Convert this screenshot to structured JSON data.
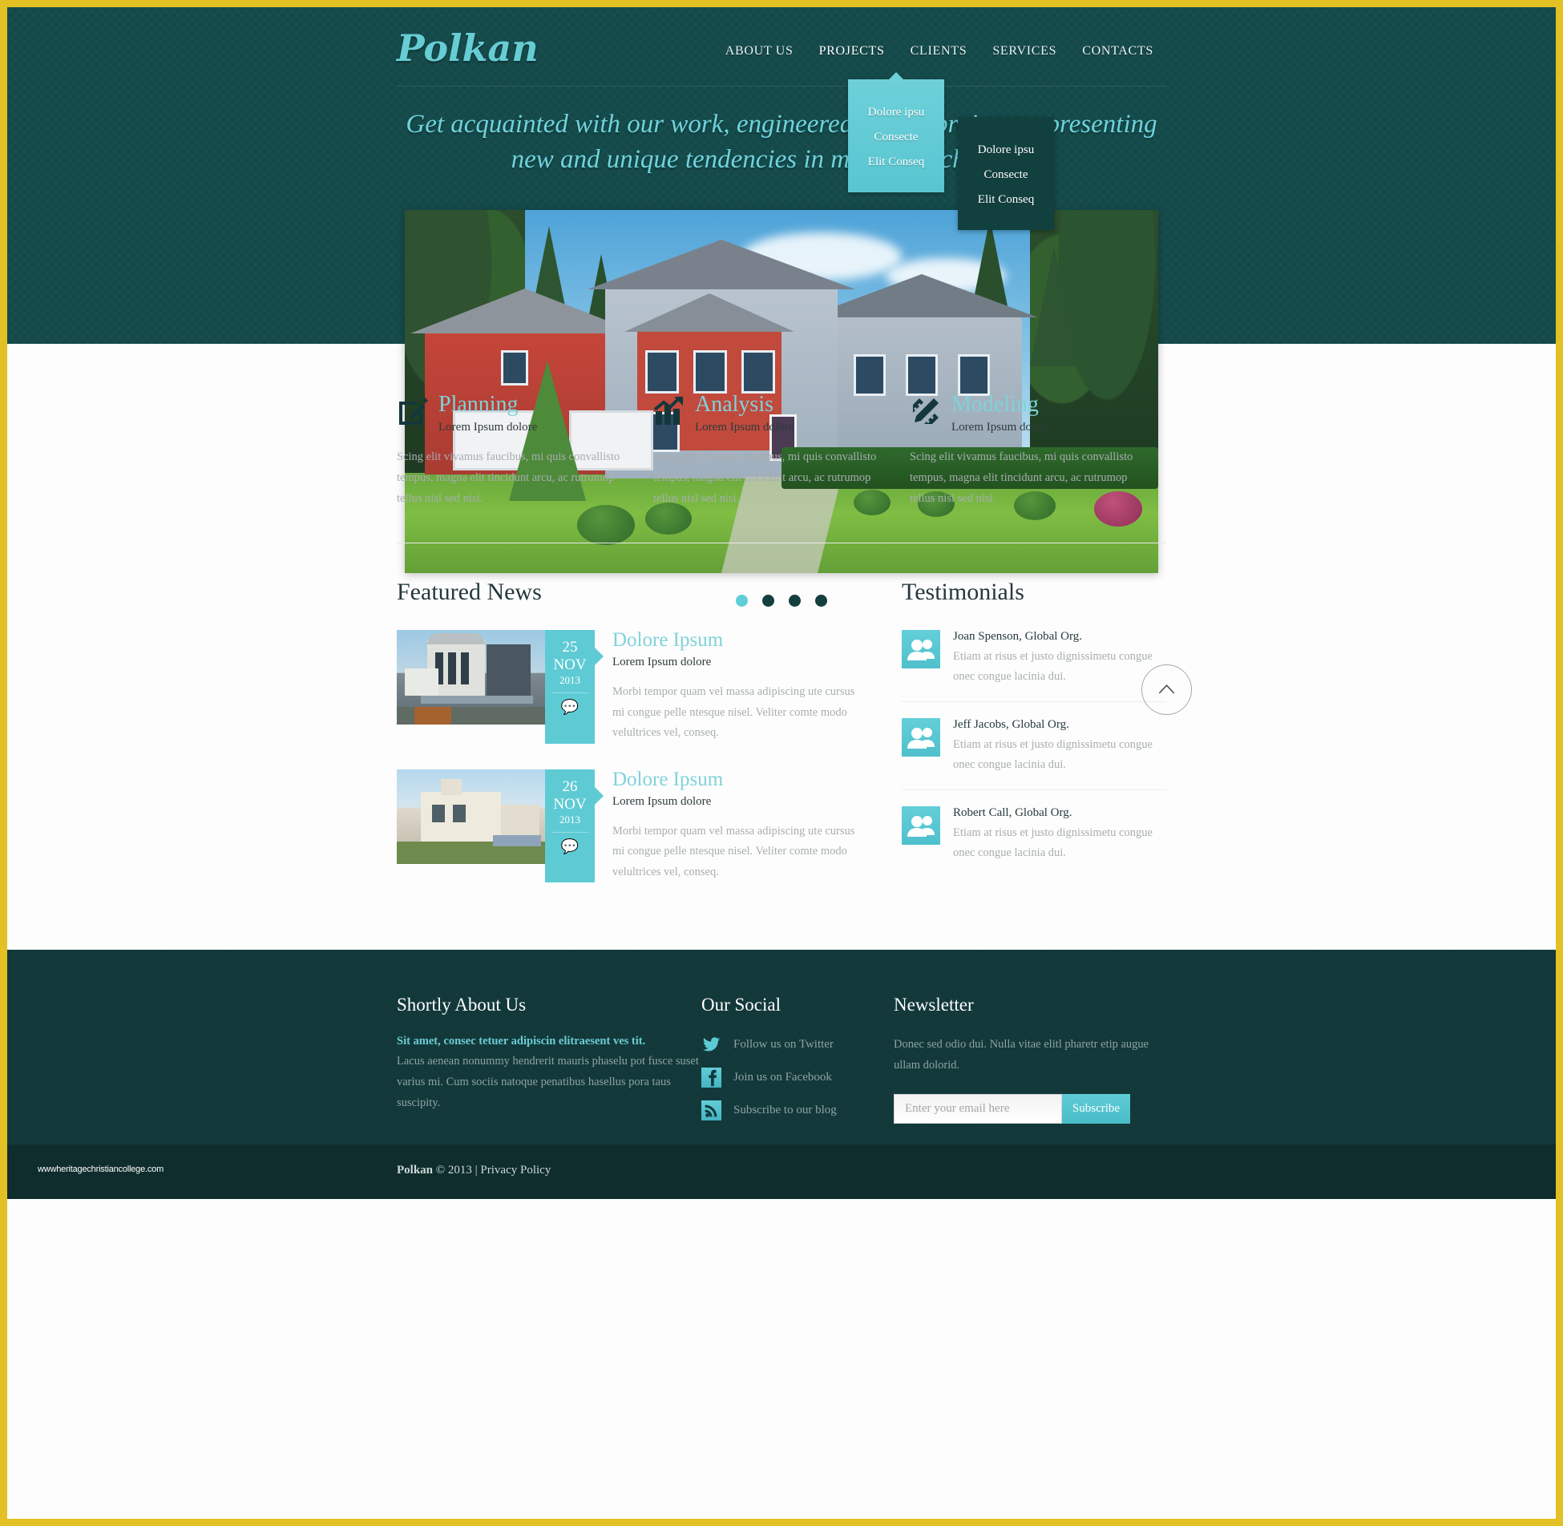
{
  "brand": {
    "logo": "Polkan"
  },
  "nav": {
    "items": [
      {
        "label": "ABOUT US",
        "active": false
      },
      {
        "label": "PROJECTS",
        "active": true
      },
      {
        "label": "CLIENTS",
        "active": false
      },
      {
        "label": "SERVICES",
        "active": false
      },
      {
        "label": "CONTACTS",
        "active": false
      }
    ],
    "dropdown_light": [
      "Dolore ipsu",
      "Consecte",
      "Elit Conseq"
    ],
    "dropdown_dark": [
      "Dolore ipsu",
      "Consecte",
      "Elit Conseq"
    ]
  },
  "hero": {
    "tagline": "Get acquainted with our work, engineered by our projects representing new and unique tendencies in modern architecture.",
    "slider_dots": 4,
    "active_dot": 1
  },
  "services": [
    {
      "icon": "pencil-square-icon",
      "title": "Planning",
      "subtitle": "Lorem Ipsum dolore",
      "text": "Scing elit vivamus faucibus, mi quis convallisto tempus, magna elit tincidunt arcu, ac rutrumop tellus nisl sed nisi."
    },
    {
      "icon": "bar-chart-arrow-icon",
      "title": "Analysis",
      "subtitle": "Lorem Ipsum dolore",
      "text": "Scing elit vivamus faucibus, mi quis convallisto tempus, magna elit tincidunt arcu, ac rutrumop tellus nisl sed nisi."
    },
    {
      "icon": "pencil-ruler-icon",
      "title": "Modeling",
      "subtitle": "Lorem Ipsum dolore",
      "text": "Scing elit vivamus faucibus, mi quis convallisto tempus, magna elit tincidunt arcu, ac rutrumop tellus nisl sed nisi."
    }
  ],
  "news": {
    "title": "Featured News",
    "items": [
      {
        "day": "25",
        "month": "NOV",
        "year": "2013",
        "title": "Dolore Ipsum",
        "subtitle": "Lorem Ipsum dolore",
        "text": "Morbi tempor quam vel massa adipiscing ute cursus mi congue pelle ntesque nisel. Veliter comte modo velultrices vel, conseq."
      },
      {
        "day": "26",
        "month": "NOV",
        "year": "2013",
        "title": "Dolore Ipsum",
        "subtitle": "Lorem Ipsum dolore",
        "text": "Morbi tempor quam vel massa adipiscing ute cursus mi congue pelle ntesque nisel. Veliter comte modo velultrices vel, conseq."
      }
    ]
  },
  "testimonials": {
    "title": "Testimonials",
    "items": [
      {
        "name": "Joan Spenson, Global Org.",
        "text": "Etiam at risus et justo dignissimetu congue onec congue lacinia dui."
      },
      {
        "name": "Jeff Jacobs, Global Org.",
        "text": "Etiam at risus et justo dignissimetu congue onec congue lacinia dui."
      },
      {
        "name": "Robert Call, Global Org.",
        "text": "Etiam at risus et justo dignissimetu congue onec congue lacinia dui."
      }
    ]
  },
  "footer": {
    "about": {
      "title": "Shortly About Us",
      "lead": "Sit amet, consec tetuer adipiscin elitraesent ves tit.",
      "text": "Lacus aenean nonummy hendrerit mauris phaselu pot fusce suset varius mi. Cum sociis natoque penatibus hasellus pora taus suscipity."
    },
    "social": {
      "title": "Our Social",
      "items": [
        {
          "icon": "twitter-icon",
          "label": "Follow us on Twitter"
        },
        {
          "icon": "facebook-icon",
          "label": "Join us on Facebook"
        },
        {
          "icon": "rss-icon",
          "label": "Subscribe to our blog"
        }
      ]
    },
    "newsletter": {
      "title": "Newsletter",
      "text": "Donec sed odio dui. Nulla vitae elitl pharetr etip augue ullam dolorid.",
      "placeholder": "Enter your email here",
      "value": "",
      "button": "Subscribe"
    }
  },
  "bottom": {
    "watermark": "wwwheritagechristiancollege.com",
    "copyright_brand": "Polkan",
    "copyright_rest": "© 2013 | Privacy Policy"
  },
  "colors": {
    "page_border": "#e3c023",
    "header_bg": "#14494a",
    "accent_cyan": "#5ecbd4",
    "footer_bg": "#12383a",
    "copybar_bg": "#0e2d2c"
  }
}
